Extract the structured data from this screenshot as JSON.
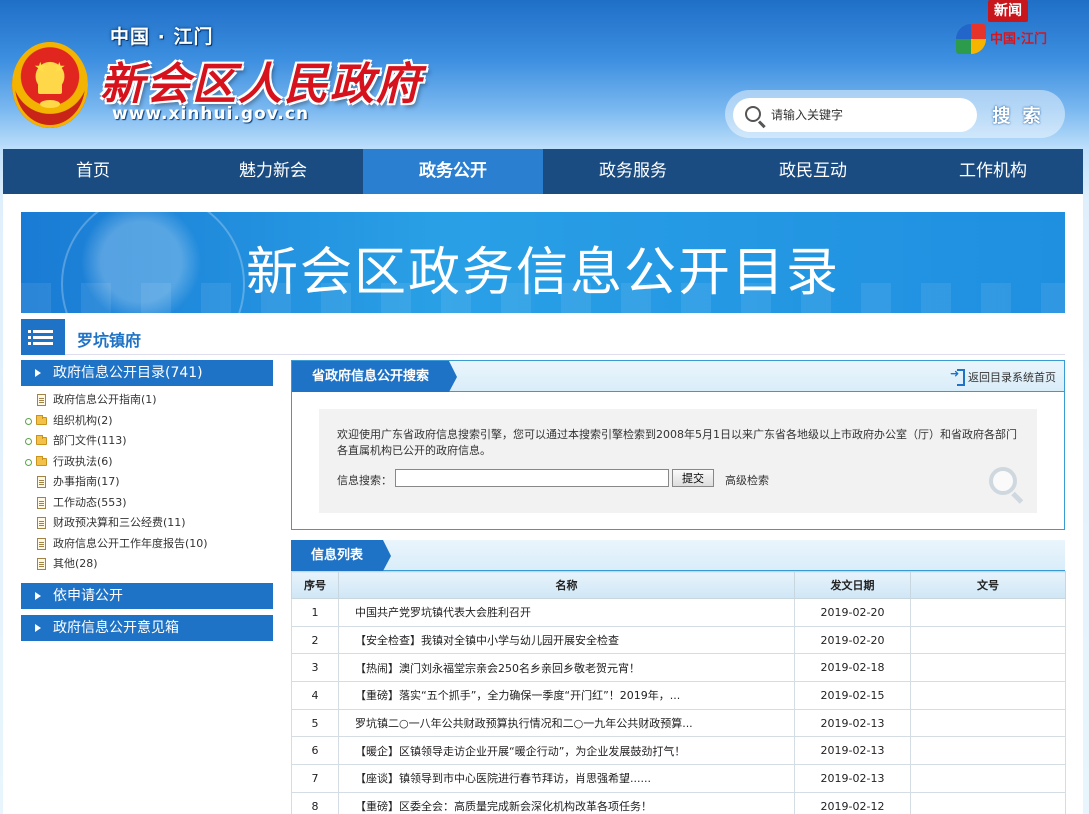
{
  "header": {
    "sub_title": "中国 · 江门",
    "site_title": "新会区人民政府",
    "site_url": "www.xinhui.gov.cn",
    "brand_seal": "新闻",
    "brand_text": "中国·江门",
    "search_placeholder": "请输入关键字",
    "search_button": "搜 索"
  },
  "nav": [
    "首页",
    "魅力新会",
    "政务公开",
    "政务服务",
    "政民互动",
    "工作机构"
  ],
  "banner_title": "新会区政务信息公开目录",
  "org_name": "罗坑镇府",
  "sidebar": {
    "catalog_head": "政府信息公开目录(741)",
    "tree": [
      {
        "label": "政府信息公开指南(1)",
        "kind": "doc",
        "expand": false
      },
      {
        "label": "组织机构(2)",
        "kind": "folder",
        "expand": true
      },
      {
        "label": "部门文件(113)",
        "kind": "folder",
        "expand": true
      },
      {
        "label": "行政执法(6)",
        "kind": "folder",
        "expand": true
      },
      {
        "label": "办事指南(17)",
        "kind": "doc",
        "expand": false
      },
      {
        "label": "工作动态(553)",
        "kind": "doc",
        "expand": false
      },
      {
        "label": "财政预决算和三公经费(11)",
        "kind": "doc",
        "expand": false
      },
      {
        "label": "政府信息公开工作年度报告(10)",
        "kind": "doc",
        "expand": false
      },
      {
        "label": "其他(28)",
        "kind": "doc",
        "expand": false
      }
    ],
    "apply_head": "依申请公开",
    "feedback_head": "政府信息公开意见箱"
  },
  "search_box": {
    "tab": "省政府信息公开搜索",
    "back_link": "返回目录系统首页",
    "intro": "欢迎使用广东省政府信息搜索引擎，您可以通过本搜索引擎检索到2008年5月1日以来广东省各地级以上市政府办公室（厅）和省政府各部门各直属机构已公开的政府信息。",
    "label": "信息搜索：",
    "submit": "提交",
    "advanced": "高级检索"
  },
  "list": {
    "tab": "信息列表",
    "columns": [
      "序号",
      "名称",
      "发文日期",
      "文号"
    ],
    "rows": [
      {
        "no": "1",
        "title": "中国共产党罗坑镇代表大会胜利召开",
        "date": "2019-02-20",
        "doc": ""
      },
      {
        "no": "2",
        "title": "【安全检查】我镇对全镇中小学与幼儿园开展安全检查",
        "date": "2019-02-20",
        "doc": ""
      },
      {
        "no": "3",
        "title": "【热闹】澳门刘永福堂宗亲会250名乡亲回乡敬老贺元宵！",
        "date": "2019-02-18",
        "doc": ""
      },
      {
        "no": "4",
        "title": "【重磅】落实“五个抓手”，全力确保一季度“开门红”！2019年，...",
        "date": "2019-02-15",
        "doc": ""
      },
      {
        "no": "5",
        "title": "罗坑镇二○一八年公共财政预算执行情况和二○一九年公共财政预算...",
        "date": "2019-02-13",
        "doc": ""
      },
      {
        "no": "6",
        "title": "【暖企】区镇领导走访企业开展“暖企行动”，为企业发展鼓劲打气！",
        "date": "2019-02-13",
        "doc": ""
      },
      {
        "no": "7",
        "title": "【座谈】镇领导到市中心医院进行春节拜访，肖思强希望......",
        "date": "2019-02-13",
        "doc": ""
      },
      {
        "no": "8",
        "title": "【重磅】区委全会：高质量完成新会深化机构改革各项任务！",
        "date": "2019-02-12",
        "doc": ""
      }
    ]
  }
}
